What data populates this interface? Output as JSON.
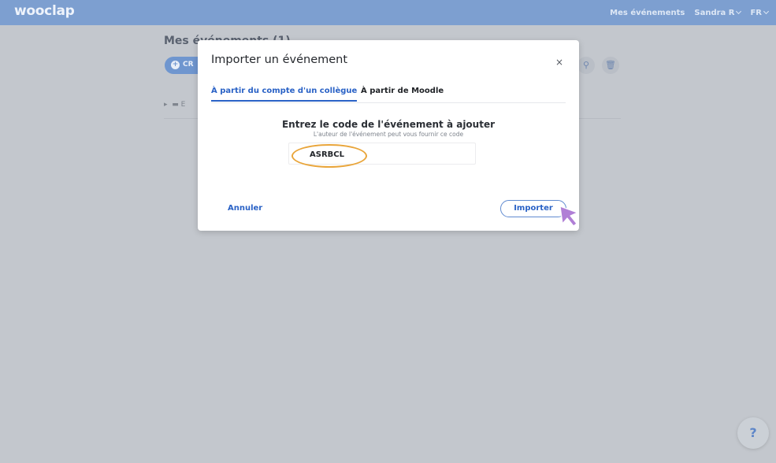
{
  "header": {
    "logo": "wooclap",
    "nav_events": "Mes événements",
    "nav_user": "Sandra R",
    "nav_lang": "FR"
  },
  "background": {
    "page_title": "Mes événements (1)",
    "create_label": "CR",
    "folder_label": "E"
  },
  "modal": {
    "title": "Importer un événement",
    "close_label": "×",
    "tabs": [
      {
        "label": "À partir du compte d'un collègue",
        "active": true
      },
      {
        "label": "À partir de Moodle",
        "active": false
      }
    ],
    "prompt_title": "Entrez le code de l'événement à ajouter",
    "prompt_subtitle": "L'auteur de l'événement peut vous fournir ce code",
    "code_value": "ASRBCL",
    "cancel_label": "Annuler",
    "import_label": "Importer"
  },
  "help": {
    "label": "?"
  },
  "colors": {
    "topbar": "#7d9fd0",
    "accent": "#2a62c6",
    "highlight": "#e9a53a",
    "cursor": "#b07fd6"
  }
}
